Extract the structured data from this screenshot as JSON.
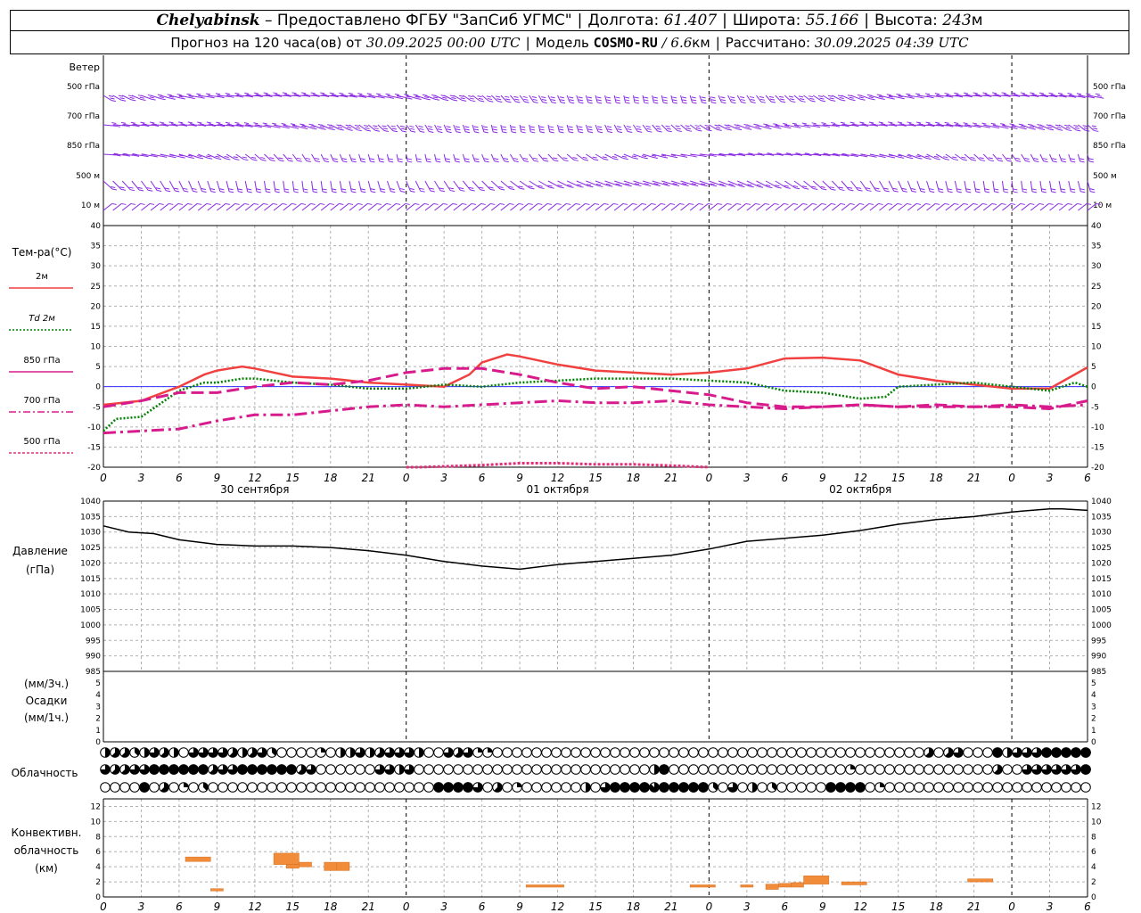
{
  "header": {
    "station": "Chelyabinsk",
    "provided": "– Предоставлено ФГБУ \"ЗапСиб УГМС\"",
    "lon_label": "Долгота:",
    "lon": "61.407",
    "lat_label": "Широта:",
    "lat": "55.166",
    "alt_label": "Высота:",
    "alt": "243",
    "alt_unit": "м",
    "forecast_label": "Прогноз на 120 часа(ов) от",
    "run_time": "30.09.2025 00:00 UTC",
    "model_label": "Модель",
    "model": "COSMO-RU",
    "resolution": "/ 6.6",
    "resolution_unit": "км",
    "calc_label": "Рассчитано:",
    "calc_time": "30.09.2025 04:39 UTC"
  },
  "time_axis": {
    "hour_labels": [
      "0",
      "3",
      "6",
      "9",
      "12",
      "15",
      "18",
      "21",
      "0",
      "3",
      "6",
      "9",
      "12",
      "15",
      "18",
      "21",
      "0",
      "3",
      "6",
      "9",
      "12",
      "15",
      "18",
      "21",
      "0",
      "3",
      "6"
    ],
    "day_labels": [
      {
        "label": "30 сентября",
        "hour": 12
      },
      {
        "label": "01 октября",
        "hour": 36
      },
      {
        "label": "02 октября",
        "hour": 60
      }
    ],
    "max_hour": 78
  },
  "colors": {
    "wind": "#8a2be2",
    "t2m": "#f04040",
    "td2m": "#008000",
    "t850": "#d81b8c",
    "t700": "#d81b8c",
    "t500": "#e0307a",
    "pressure": "#000000",
    "conv": "#f08c3a",
    "zero_line": "#3333ff"
  },
  "panels": {
    "wind": {
      "title": "Ветер",
      "levels": [
        "500 гПа",
        "700 гПа",
        "850 гПа",
        "500 м",
        "10 м"
      ]
    },
    "temperature": {
      "title": "Тем-ра(°C)",
      "legend": [
        {
          "label": "2м",
          "style": "solid"
        },
        {
          "label": "Td 2м",
          "style": "dotted"
        },
        {
          "label": "850 гПа",
          "style": "dashed"
        },
        {
          "label": "700 гПа",
          "style": "dashdot"
        },
        {
          "label": "500 гПа",
          "style": "shortdash"
        }
      ],
      "y_ticks": [
        "40",
        "35",
        "30",
        "25",
        "20",
        "15",
        "10",
        "5",
        "0",
        "-5",
        "-10",
        "-15",
        "-20"
      ]
    },
    "pressure": {
      "title1": "Давление",
      "title2": "(гПа)",
      "y_ticks": [
        "1040",
        "1035",
        "1030",
        "1025",
        "1020",
        "1015",
        "1010",
        "1005",
        "1000",
        "995",
        "990",
        "985"
      ]
    },
    "precip": {
      "line1": "(мм/3ч.)",
      "line2": "Осадки",
      "line3": "(мм/1ч.)",
      "y_ticks": [
        "5",
        "4",
        "3",
        "2",
        "1",
        "0"
      ]
    },
    "cloud": {
      "title": "Облачность"
    },
    "convective": {
      "line1": "Конвективн.",
      "line2": "облачность",
      "line3": "(км)",
      "y_ticks": [
        "12",
        "10",
        "8",
        "6",
        "4",
        "2",
        "0"
      ]
    }
  },
  "chart_data": [
    {
      "type": "line",
      "title": "Тем-ра(°C)",
      "ylim": [
        -20,
        40
      ],
      "series": [
        {
          "name": "2м",
          "x": [
            0,
            3,
            6,
            8,
            9,
            11,
            12,
            15,
            18,
            21,
            24,
            27,
            29,
            30,
            32,
            33,
            36,
            39,
            42,
            45,
            48,
            51,
            54,
            57,
            60,
            63,
            66,
            69,
            72,
            75,
            78
          ],
          "values": [
            -4.5,
            -3.5,
            0,
            3,
            4,
            5,
            4.5,
            2.5,
            2,
            1,
            0.5,
            0,
            3,
            6,
            8,
            7.5,
            5.5,
            4,
            3.5,
            3,
            3.5,
            4.5,
            7,
            7.2,
            6.5,
            3,
            1.5,
            0.5,
            -0.5,
            -0.5,
            4.8
          ]
        },
        {
          "name": "Td 2м",
          "x": [
            0,
            1,
            3,
            6,
            8,
            9,
            11,
            12,
            15,
            18,
            21,
            24,
            27,
            30,
            33,
            36,
            39,
            42,
            45,
            48,
            51,
            54,
            57,
            60,
            62,
            63,
            66,
            69,
            72,
            75,
            77,
            78
          ],
          "values": [
            -11,
            -8,
            -7.5,
            -1,
            1,
            1,
            2,
            2,
            1,
            0.5,
            -0.5,
            -0.5,
            0.5,
            0,
            1,
            1.5,
            2,
            2,
            2,
            1.5,
            1,
            -1,
            -1.5,
            -3,
            -2.5,
            0,
            0.5,
            1,
            0,
            -1,
            1,
            0
          ]
        },
        {
          "name": "850 гПа",
          "x": [
            0,
            3,
            6,
            9,
            12,
            15,
            18,
            21,
            24,
            27,
            30,
            33,
            36,
            39,
            42,
            45,
            48,
            51,
            54,
            57,
            60,
            63,
            66,
            69,
            72,
            75,
            78
          ],
          "values": [
            -5,
            -3.5,
            -1.5,
            -1.5,
            0,
            1,
            0.5,
            1.5,
            3.5,
            4.5,
            4.5,
            3,
            1,
            -0.5,
            0,
            -1,
            -2,
            -4,
            -5,
            -5,
            -4.5,
            -5,
            -4.5,
            -5,
            -5,
            -5.5,
            -3.5
          ]
        },
        {
          "name": "700 гПа",
          "x": [
            0,
            3,
            6,
            9,
            12,
            15,
            18,
            21,
            24,
            27,
            30,
            33,
            36,
            39,
            42,
            45,
            48,
            51,
            54,
            57,
            60,
            63,
            66,
            69,
            72,
            75,
            78
          ],
          "values": [
            -11.5,
            -11,
            -10.5,
            -8.5,
            -7,
            -7,
            -6,
            -5,
            -4.5,
            -5,
            -4.5,
            -4,
            -3.5,
            -4,
            -4,
            -3.5,
            -4.5,
            -5,
            -5.5,
            -5,
            -4.5,
            -5,
            -5,
            -5,
            -4.5,
            -5,
            -4.5
          ]
        },
        {
          "name": "500 гПа",
          "x": [
            24,
            25,
            30,
            33,
            36,
            39,
            42,
            45,
            48
          ],
          "values": [
            -20,
            -20,
            -19.5,
            -19,
            -19,
            -19.3,
            -19.3,
            -19.6,
            -20
          ]
        }
      ]
    },
    {
      "type": "line",
      "title": "Давление (гПа)",
      "ylim": [
        985,
        1040
      ],
      "series": [
        {
          "name": "",
          "x": [
            0,
            2,
            4,
            6,
            9,
            12,
            15,
            18,
            21,
            24,
            27,
            30,
            33,
            36,
            39,
            42,
            45,
            48,
            51,
            54,
            57,
            60,
            63,
            66,
            69,
            72,
            75,
            76,
            78
          ],
          "values": [
            1032,
            1030,
            1029.5,
            1027.5,
            1026,
            1025.5,
            1025.5,
            1025,
            1024,
            1022.5,
            1020.5,
            1019,
            1018,
            1019.5,
            1020.5,
            1021.5,
            1022.5,
            1024.5,
            1027,
            1028,
            1029,
            1030.5,
            1032.5,
            1034,
            1035,
            1036.5,
            1037.5,
            1037.5,
            1037
          ]
        }
      ]
    },
    {
      "type": "bar",
      "title": "Конвективн. облачность (км)",
      "ylim": [
        0,
        13
      ],
      "series": [
        {
          "name": "",
          "segments": [
            [
              6.5,
              8.5,
              4.7,
              5.3
            ],
            [
              8.5,
              9.5,
              0.8,
              1.1
            ],
            [
              13.5,
              15.5,
              4.3,
              5.8
            ],
            [
              14.5,
              15.5,
              3.8,
              4.3
            ],
            [
              15.5,
              16.5,
              4.0,
              4.6
            ],
            [
              17.5,
              18.5,
              3.5,
              4.6
            ],
            [
              18.5,
              19.5,
              3.5,
              4.6
            ],
            [
              33.5,
              36.5,
              1.3,
              1.6
            ],
            [
              46.5,
              48.5,
              1.3,
              1.6
            ],
            [
              50.5,
              51.5,
              1.3,
              1.6
            ],
            [
              52.5,
              53.5,
              1.0,
              1.7
            ],
            [
              53.5,
              54.5,
              1.3,
              1.8
            ],
            [
              54.5,
              55.5,
              1.3,
              1.9
            ],
            [
              55.5,
              57.5,
              1.7,
              2.8
            ],
            [
              58.5,
              60.5,
              1.6,
              2.0
            ],
            [
              68.5,
              70.5,
              2.0,
              2.4
            ]
          ]
        }
      ]
    }
  ],
  "cloud_cover": {
    "rows": [
      [
        4,
        5,
        5,
        3,
        4,
        6,
        5,
        4,
        0,
        6,
        6,
        6,
        6,
        5,
        4,
        5,
        6,
        3,
        0,
        0,
        0,
        0,
        2,
        0,
        4,
        4,
        6,
        4,
        5,
        6,
        6,
        6,
        4,
        0,
        0,
        6,
        5,
        6,
        2,
        2,
        0,
        0,
        0,
        0,
        0,
        0,
        0,
        0,
        0,
        0,
        0,
        0,
        0,
        0,
        0,
        0,
        0,
        0,
        0,
        0,
        0,
        0,
        0,
        0,
        0,
        0,
        0,
        0,
        0,
        0,
        0,
        0,
        0,
        0,
        0,
        0,
        0,
        0,
        0,
        0,
        0,
        0,
        0,
        0,
        5,
        0,
        5,
        6,
        0,
        0,
        0,
        8,
        4,
        6,
        6,
        6,
        8,
        8,
        8,
        8,
        8
      ],
      [
        6,
        5,
        5,
        6,
        6,
        8,
        8,
        8,
        8,
        8,
        8,
        5,
        6,
        6,
        8,
        8,
        8,
        8,
        8,
        8,
        5,
        6,
        0,
        0,
        0,
        0,
        0,
        0,
        6,
        6,
        4,
        6,
        0,
        0,
        0,
        0,
        0,
        0,
        0,
        0,
        0,
        0,
        0,
        0,
        0,
        0,
        0,
        0,
        0,
        0,
        0,
        0,
        0,
        0,
        0,
        0,
        4,
        8,
        0,
        0,
        0,
        0,
        0,
        0,
        0,
        0,
        0,
        0,
        0,
        0,
        0,
        0,
        0,
        0,
        0,
        0,
        2,
        0,
        0,
        0,
        0,
        0,
        0,
        0,
        0,
        0,
        0,
        0,
        0,
        0,
        0,
        5,
        0,
        0,
        6,
        6,
        6,
        6,
        6,
        6,
        8
      ],
      [
        0,
        0,
        0,
        0,
        8,
        0,
        5,
        0,
        2,
        0,
        3,
        0,
        0,
        0,
        0,
        0,
        0,
        0,
        0,
        0,
        0,
        0,
        0,
        0,
        0,
        0,
        0,
        0,
        0,
        0,
        0,
        0,
        0,
        0,
        8,
        8,
        8,
        8,
        6,
        0,
        5,
        0,
        2,
        0,
        0,
        0,
        0,
        0,
        0,
        4,
        0,
        6,
        8,
        8,
        8,
        8,
        7,
        8,
        8,
        8,
        8,
        8,
        3,
        0,
        6,
        0,
        4,
        0,
        3,
        0,
        0,
        0,
        0,
        0,
        8,
        8,
        8,
        8,
        0,
        2,
        0,
        0,
        0,
        0,
        0,
        0,
        0,
        0,
        0,
        0,
        0,
        0,
        0,
        0,
        0,
        0,
        0,
        0,
        0,
        0,
        0
      ]
    ]
  }
}
